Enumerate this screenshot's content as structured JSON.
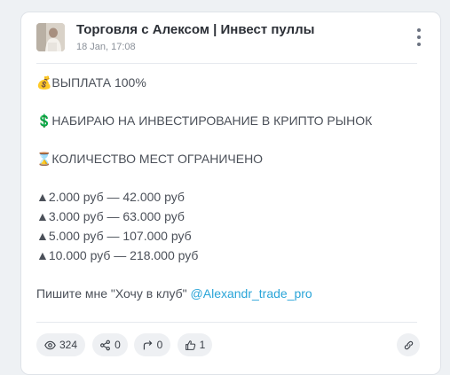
{
  "post": {
    "channel_name": "Торговля с Алексом | Инвест пуллы",
    "date": "18 Jan, 17:08",
    "lines": {
      "payout": "💰ВЫПЛАТА 100%",
      "recruiting": "💲НАБИРАЮ НА ИНВЕСТИРОВАНИЕ В КРИПТО РЫНОК",
      "limited": "⌛КОЛИЧЕСТВО МЕСТ ОГРАНИЧЕНО",
      "tier1": "▲2.000 руб — 42.000 руб",
      "tier2": "▲3.000 руб — 63.000 руб",
      "tier3": "▲5.000 руб — 107.000 руб",
      "tier4": "▲10.000 руб — 218.000 руб",
      "cta": "Пишите мне \"Хочу в клуб\" ",
      "cta_link": "@Alexandr_trade_pro"
    }
  },
  "stats": {
    "views": "324",
    "shares": "0",
    "forwards": "0",
    "likes": "1"
  },
  "icons": {
    "views": "eye-icon",
    "shares": "share-icon",
    "forwards": "forward-icon",
    "likes": "thumbs-up-icon",
    "link": "link-icon",
    "menu": "more-vertical-icon"
  },
  "colors": {
    "link": "#2aa5d8",
    "text": "#4b5059",
    "title": "#2b2f36"
  }
}
